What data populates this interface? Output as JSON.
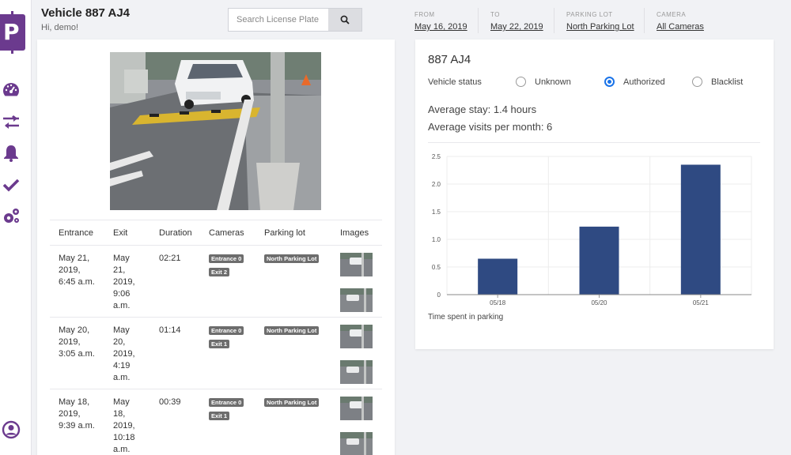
{
  "header": {
    "title": "Vehicle 887 AJ4",
    "greeting": "Hi, demo!",
    "search_placeholder": "Search License Plate",
    "filters": [
      {
        "label": "FROM",
        "value": "May 16, 2019"
      },
      {
        "label": "TO",
        "value": "May 22, 2019"
      },
      {
        "label": "PARKING LOT",
        "value": "North Parking Lot"
      },
      {
        "label": "CAMERA",
        "value": "All Cameras"
      }
    ]
  },
  "sidebar": {
    "logo_letter": "P",
    "icons": [
      "dashboard-icon",
      "transfer-arrows-icon",
      "bell-icon",
      "checkmark-icon",
      "settings-gears-icon",
      "user-account-icon"
    ]
  },
  "history": {
    "columns": [
      "Entrance",
      "Exit",
      "Duration",
      "Cameras",
      "Parking lot",
      "Images"
    ],
    "rows": [
      {
        "entrance": [
          "May 21,",
          "2019,",
          "6:45 a.m."
        ],
        "exit": [
          "May",
          "21,",
          "2019,",
          "9:06",
          "a.m."
        ],
        "duration": "02:21",
        "cameras": [
          "Entrance 0",
          "Exit 2"
        ],
        "lot": "North Parking Lot"
      },
      {
        "entrance": [
          "May 20,",
          "2019,",
          "3:05 a.m."
        ],
        "exit": [
          "May",
          "20,",
          "2019,",
          "4:19",
          "a.m."
        ],
        "duration": "01:14",
        "cameras": [
          "Entrance 0",
          "Exit 1"
        ],
        "lot": "North Parking Lot"
      },
      {
        "entrance": [
          "May 18,",
          "2019,",
          "9:39 a.m."
        ],
        "exit": [
          "May",
          "18,",
          "2019,",
          "10:18",
          "a.m."
        ],
        "duration": "00:39",
        "cameras": [
          "Entrance 0",
          "Exit 1"
        ],
        "lot": "North Parking Lot"
      }
    ]
  },
  "vehicle": {
    "plate": "887 AJ4",
    "status_label": "Vehicle status",
    "status_options": [
      "Unknown",
      "Authorized",
      "Blacklist"
    ],
    "status_selected": "Authorized",
    "avg_stay": "Average stay: 1.4 hours",
    "avg_visits": "Average visits per month: 6"
  },
  "colors": {
    "brand": "#6b3a8e",
    "bar": "#2f4a82",
    "radio_selected": "#1a73e8"
  },
  "chart_data": {
    "type": "bar",
    "categories": [
      "05/18",
      "05/20",
      "05/21"
    ],
    "values": [
      0.65,
      1.23,
      2.35
    ],
    "ylim": [
      0,
      2.5
    ],
    "yticks": [
      0,
      0.5,
      1.0,
      1.5,
      2.0,
      2.5
    ],
    "ytick_labels": [
      "0",
      "0.5",
      "1.0",
      "1.5",
      "2.0",
      "2.5"
    ],
    "title": "",
    "caption": "Time spent in parking",
    "grid": true
  }
}
